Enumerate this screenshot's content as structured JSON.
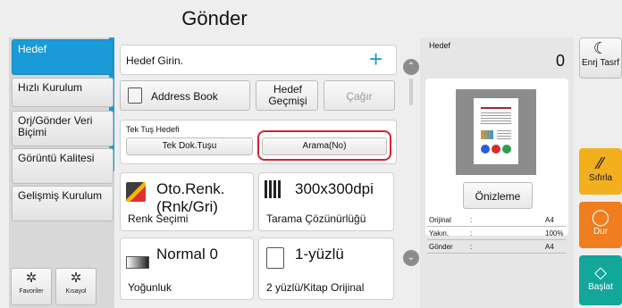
{
  "header": {
    "title": "Gönder"
  },
  "sidebar": {
    "items": [
      {
        "label": "Hedef"
      },
      {
        "label": "Hızlı Kurulum"
      },
      {
        "label": "Orj/Gönder Veri Biçimi"
      },
      {
        "label": "Görüntü Kalitesi"
      },
      {
        "label": "Gelişmiş Kurulum"
      }
    ],
    "bottom": [
      {
        "label": "Favoriler"
      },
      {
        "label": "Kısayol"
      }
    ]
  },
  "dest": {
    "input_label": "Hedef Girin.",
    "address_book": "Address Book",
    "history": "Hedef Geçmişi",
    "recall": "Çağır",
    "one_touch_title": "Tek Tuş Hedefi",
    "one_touch_key": "Tek Dok.Tuşu",
    "dial": "Arama(No)"
  },
  "tiles": [
    {
      "value": "Oto.Renk.(Rnk/Gri)",
      "caption": "Renk Seçimi"
    },
    {
      "value": "300x300dpi",
      "caption": "Tarama Çözünürlüğü"
    },
    {
      "value": "Normal 0",
      "caption": "Yoğunluk"
    },
    {
      "value": "1-yüzlü",
      "caption": "2 yüzlü/Kitap Orijinal"
    }
  ],
  "preview": {
    "dest_label": "Hedef",
    "dest_count": "0",
    "button": "Önizleme",
    "rows": [
      {
        "label": "Orijinal",
        "sep": ":",
        "value": "A4"
      },
      {
        "label": "Yakın.",
        "sep": ":",
        "value": "100%"
      },
      {
        "label": "Gönder",
        "sep": ":",
        "value": "A4"
      }
    ]
  },
  "right": {
    "energy": "Enrj Tasrf",
    "reset": "Sıfırla",
    "stop": "Dur",
    "start": "Başlat"
  },
  "colors": {
    "accent": "#1a9bd7",
    "reset": "#f2b01e",
    "stop": "#f07d1e",
    "start": "#13a79a",
    "highlight": "#d9222a"
  }
}
